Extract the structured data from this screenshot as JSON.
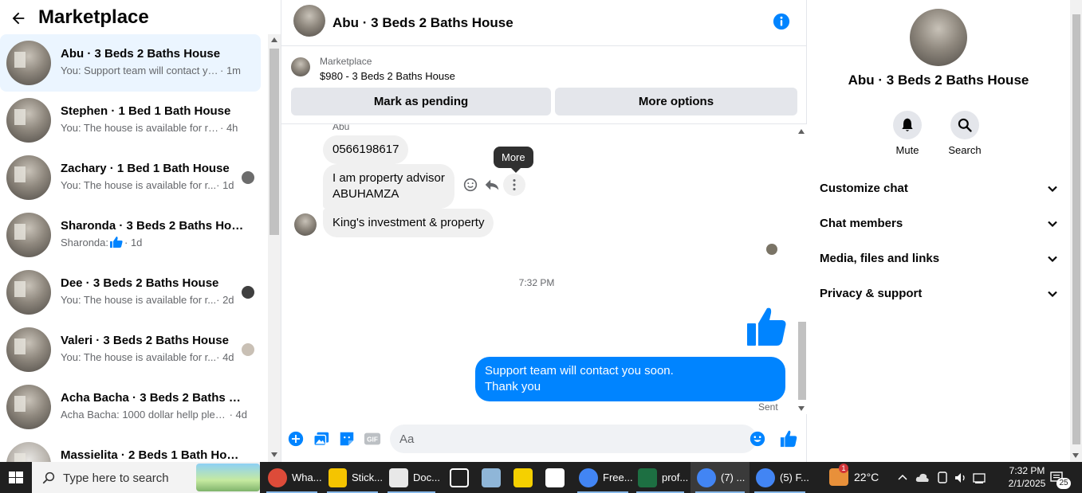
{
  "sidebar": {
    "title": "Marketplace",
    "conversations": [
      {
        "name": "Abu · 3 Beds 2 Baths House",
        "snippet": "You: Support team will contact yo...",
        "time": " · 1m",
        "active": true
      },
      {
        "name": "Stephen · 1 Bed 1 Bath House",
        "snippet": "You: The house is available for rent,...",
        "time": " · 4h"
      },
      {
        "name": "Zachary · 1 Bed 1 Bath House",
        "snippet": "You: The house is available for r...",
        "time": " · 1d"
      },
      {
        "name": "Sharonda · 3 Beds 2 Baths House",
        "snippet": "Sharonda:",
        "time": " · 1d"
      },
      {
        "name": "Dee · 3 Beds 2 Baths House",
        "snippet": "You: The house is available for r...",
        "time": " · 2d"
      },
      {
        "name": "Valeri · 3 Beds 2 Baths House",
        "snippet": "You: The house is available for r...",
        "time": " · 4d"
      },
      {
        "name": "Acha Bacha · 3 Beds 2 Baths Ho...",
        "snippet": "Acha Bacha: 1000 dollar hellp please",
        "time": " · 4d"
      },
      {
        "name": "Massielita · 2 Beds 1 Bath Hou...",
        "snippet": "",
        "time": ""
      }
    ]
  },
  "chat": {
    "title": "Abu · 3 Beds 2 Baths House",
    "listing": {
      "source": "Marketplace",
      "price_title": "$980 - 3 Beds 2 Baths House",
      "pending_label": "Mark as pending",
      "more_label": "More options"
    },
    "sender_name": "Abu",
    "messages_in": [
      "0566198617",
      "I am property advisor\nABUHAMZA",
      "King's investment & property"
    ],
    "tooltip": "More",
    "timestamp": "7:32 PM",
    "message_out_line1": "Support team will contact you soon.",
    "message_out_line2": "Thank you",
    "sent_label": "Sent",
    "composer_placeholder": "Aa",
    "composer_icons": [
      "plus-icon",
      "image-icon",
      "sticker-icon",
      "gif-icon",
      "emoji-icon",
      "like-icon"
    ]
  },
  "details": {
    "title": "Abu · 3 Beds 2 Baths House",
    "actions": [
      {
        "label": "Mute",
        "icon": "bell-icon"
      },
      {
        "label": "Search",
        "icon": "search-icon"
      }
    ],
    "sections": [
      "Customize chat",
      "Chat members",
      "Media, files and links",
      "Privacy & support"
    ]
  },
  "taskbar": {
    "search_placeholder": "Type here to search",
    "apps": [
      {
        "label": "Wha...",
        "color": "#dd4b39"
      },
      {
        "label": "Stick...",
        "color": "#f5c400"
      },
      {
        "label": "Doc...",
        "color": "#e8e8e8"
      },
      {
        "label": "",
        "color": "#ffffff"
      },
      {
        "label": "",
        "color": "#8fb6d8"
      },
      {
        "label": "",
        "color": "#f5d000"
      },
      {
        "label": "",
        "color": "#ffffff"
      },
      {
        "label": "Free...",
        "color": "#4285f4"
      },
      {
        "label": "prof...",
        "color": "#1d6f42"
      },
      {
        "label": "(7) ...",
        "color": "#4285f4"
      },
      {
        "label": "(5) F...",
        "color": "#4285f4"
      }
    ],
    "weather": "22°C",
    "weather_badge": "1",
    "time": "7:32 PM",
    "date": "2/1/2025",
    "notifications": "25"
  },
  "colors": {
    "messenger_blue": "#0084ff",
    "active_row": "#ebf5ff",
    "taskbar": "#202020"
  }
}
